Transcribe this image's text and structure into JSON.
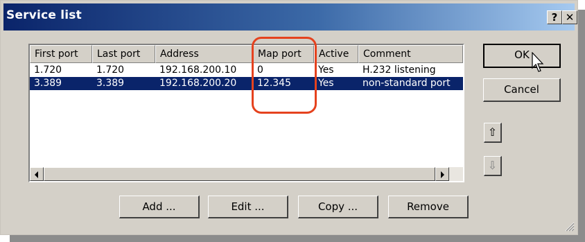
{
  "window": {
    "title": "Service list",
    "help_label": "?",
    "close_label": "✕"
  },
  "list": {
    "columns": [
      "First port",
      "Last port",
      "Address",
      "Map port",
      "Active",
      "Comment"
    ],
    "rows": [
      {
        "first_port": "1.720",
        "last_port": "1.720",
        "address": "192.168.200.10",
        "map_port": "0",
        "active": "Yes",
        "comment": "H.232 listening",
        "selected": false
      },
      {
        "first_port": "3.389",
        "last_port": "3.389",
        "address": "192.168.200.20",
        "map_port": "12.345",
        "active": "Yes",
        "comment": "non-standard port",
        "selected": true
      }
    ]
  },
  "buttons": {
    "ok": "OK",
    "cancel": "Cancel",
    "move_up": "⇧",
    "move_down": "⇩",
    "add": "Add ...",
    "edit": "Edit ...",
    "copy": "Copy ...",
    "remove": "Remove"
  },
  "highlight_color": "#e5421e",
  "selection_color": "#0a246a"
}
